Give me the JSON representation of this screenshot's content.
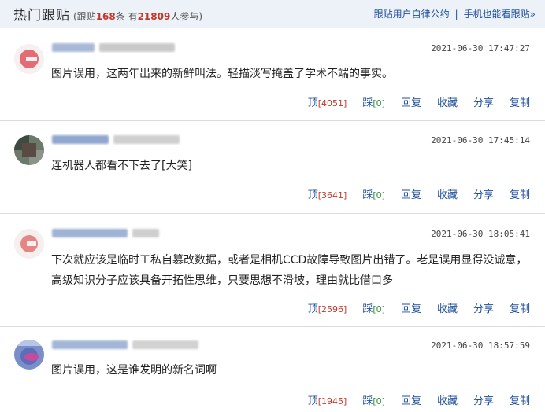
{
  "header": {
    "title": "热门跟贴",
    "stats_prefix": "(跟贴",
    "post_count": "168",
    "stats_mid": "条 有",
    "participants": "21809",
    "stats_suffix": "人参与)",
    "link_rules": "跟贴用户自律公约",
    "separator": "|",
    "link_mobile": "手机也能看跟贴»"
  },
  "action_labels": {
    "up": "顶",
    "down": "踩",
    "reply": "回复",
    "collect": "收藏",
    "share": "分享",
    "copy": "复制"
  },
  "comments": [
    {
      "time": "2021-06-30 17:47:27",
      "lines": [
        "图片误用，这两年出来的新鲜叫法。轻描淡写掩盖了学术不端的事实。"
      ],
      "up": "[4051]",
      "down": "[0]",
      "avatar_color": "#e0555f"
    },
    {
      "time": "2021-06-30 17:45:14",
      "lines": [
        "连机器人都看不下去了[大笑]"
      ],
      "up": "[3641]",
      "down": "[0]",
      "avatar_color": "#4a5a4c"
    },
    {
      "time": "2021-06-30 18:05:41",
      "lines": [
        "下次就应该是临时工私自篡改数据，或者是相机CCD故障导致图片出错了。老是误用显得没诚意，",
        "高级知识分子应该具备开拓性思维，只要思想不滑坡，理由就比借口多"
      ],
      "up": "[2596]",
      "down": "[0]",
      "avatar_color": "#e06b6b"
    },
    {
      "time": "2021-06-30 18:57:59",
      "lines": [
        "图片误用，这是谁发明的新名词啊"
      ],
      "up": "[1945]",
      "down": "[0]",
      "avatar_color": "#8a5fb5"
    }
  ]
}
